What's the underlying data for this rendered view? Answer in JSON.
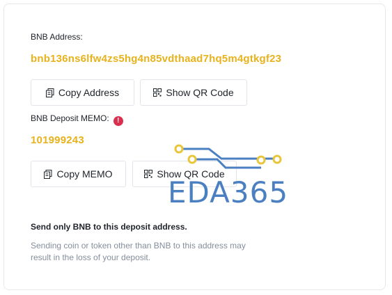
{
  "deposit": {
    "address_label": "BNB Address:",
    "address_value": "bnb136ns6lfw4zs5hg4n85vdthaad7hq5m4gtkgf23",
    "copy_address_label": "Copy Address",
    "show_qr_label": "Show QR Code",
    "memo_label": "BNB Deposit MEMO:",
    "memo_alert_glyph": "!",
    "memo_value": "101999243",
    "copy_memo_label": "Copy MEMO",
    "show_qr_memo_label": "Show QR Code"
  },
  "warning": {
    "title": "Send only BNB to this deposit address.",
    "text": "Sending coin or token other than BNB to this address may result in the loss of your deposit."
  },
  "watermark": {
    "text": "EDA365"
  },
  "icons": {
    "copy": "copy-icon",
    "qr": "qr-code-icon",
    "alert": "alert-icon"
  },
  "colors": {
    "accent": "#e7b21c",
    "alert": "#d9304f",
    "muted_text": "#848e9c",
    "watermark": "#4a7fc1"
  }
}
